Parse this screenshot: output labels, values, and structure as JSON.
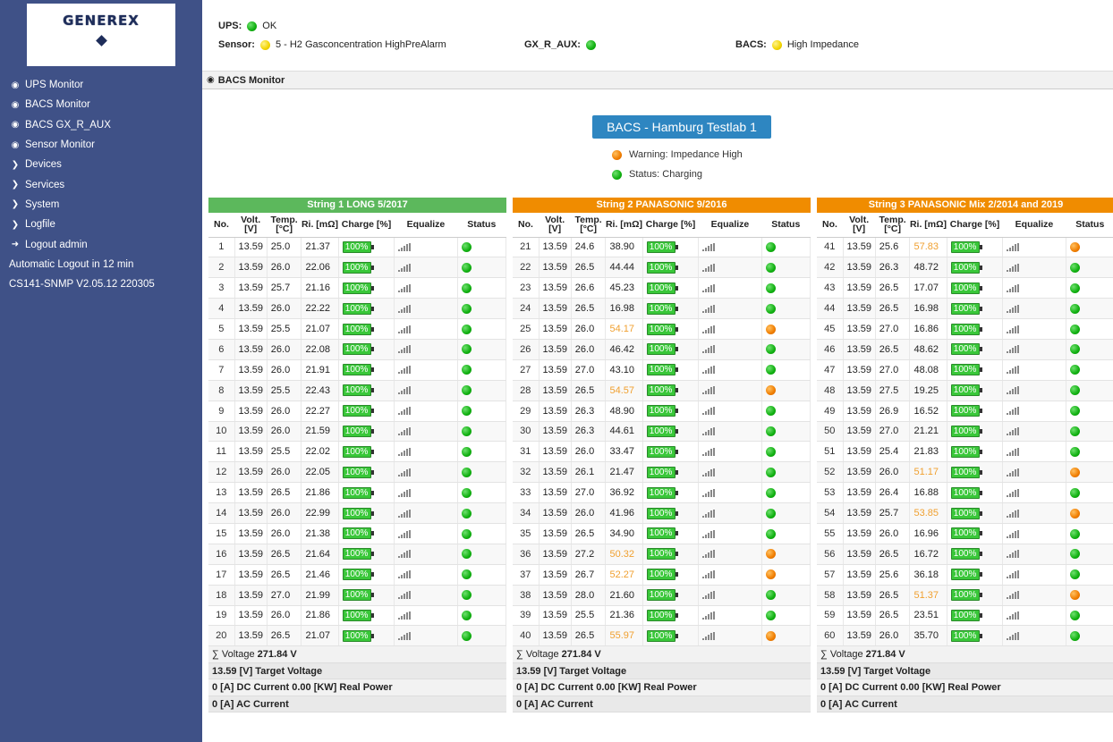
{
  "logo": {
    "text": "GENEREX"
  },
  "sidebar": {
    "items": [
      {
        "label": "UPS Monitor",
        "icon": "dashboard-icon"
      },
      {
        "label": "BACS Monitor",
        "icon": "dashboard-icon"
      },
      {
        "label": "BACS GX_R_AUX",
        "icon": "dashboard-icon"
      },
      {
        "label": "Sensor Monitor",
        "icon": "dashboard-icon"
      },
      {
        "label": "Devices",
        "icon": "chevron-right-icon"
      },
      {
        "label": "Services",
        "icon": "chevron-right-icon"
      },
      {
        "label": "System",
        "icon": "chevron-right-icon"
      },
      {
        "label": "Logfile",
        "icon": "chevron-right-icon"
      },
      {
        "label": "Logout admin",
        "icon": "logout-icon"
      }
    ],
    "auto_logout": "Automatic Logout in 12 min",
    "version": "CS141-SNMP V2.05.12 220305"
  },
  "header": {
    "ups_label": "UPS:",
    "ups_value": "OK",
    "sensor_label": "Sensor:",
    "sensor_value": "5 - H2 Gasconcentration HighPreAlarm",
    "gx_label": "GX_R_AUX:",
    "bacs_label": "BACS:",
    "bacs_value": "High Impedance"
  },
  "breadcrumb": {
    "title": "BACS Monitor"
  },
  "main": {
    "title": "BACS - Hamburg Testlab 1",
    "legend_warning": "Warning: Impedance High",
    "legend_status": "Status: Charging"
  },
  "colors": {
    "ok": "#10b010",
    "warning": "#f07d00",
    "sidebar": "#3f5187",
    "title_blue": "#2e86c1"
  },
  "columns": {
    "no": "No.",
    "volt": "Volt. [V]",
    "temp": "Temp. [°C]",
    "ri": "Ri. [mΩ]",
    "charge": "Charge [%]",
    "equalize": "Equalize",
    "status": "Status"
  },
  "charge_label": "100%",
  "strings": [
    {
      "title": "String 1 LONG 5/2017",
      "color": "green",
      "rows": [
        [
          1,
          "13.59",
          "25.0",
          "21.37",
          "ok"
        ],
        [
          2,
          "13.59",
          "26.0",
          "22.06",
          "ok"
        ],
        [
          3,
          "13.59",
          "25.7",
          "21.16",
          "ok"
        ],
        [
          4,
          "13.59",
          "26.0",
          "22.22",
          "ok"
        ],
        [
          5,
          "13.59",
          "25.5",
          "21.07",
          "ok"
        ],
        [
          6,
          "13.59",
          "26.0",
          "22.08",
          "ok"
        ],
        [
          7,
          "13.59",
          "26.0",
          "21.91",
          "ok"
        ],
        [
          8,
          "13.59",
          "25.5",
          "22.43",
          "ok"
        ],
        [
          9,
          "13.59",
          "26.0",
          "22.27",
          "ok"
        ],
        [
          10,
          "13.59",
          "26.0",
          "21.59",
          "ok"
        ],
        [
          11,
          "13.59",
          "25.5",
          "22.02",
          "ok"
        ],
        [
          12,
          "13.59",
          "26.0",
          "22.05",
          "ok"
        ],
        [
          13,
          "13.59",
          "26.5",
          "21.86",
          "ok"
        ],
        [
          14,
          "13.59",
          "26.0",
          "22.99",
          "ok"
        ],
        [
          15,
          "13.59",
          "26.0",
          "21.38",
          "ok"
        ],
        [
          16,
          "13.59",
          "26.5",
          "21.64",
          "ok"
        ],
        [
          17,
          "13.59",
          "26.5",
          "21.46",
          "ok"
        ],
        [
          18,
          "13.59",
          "27.0",
          "21.99",
          "ok"
        ],
        [
          19,
          "13.59",
          "26.0",
          "21.86",
          "ok"
        ],
        [
          20,
          "13.59",
          "26.5",
          "21.07",
          "ok"
        ]
      ],
      "voltage_label": "∑ Voltage",
      "voltage_value": "271.84 V",
      "target": "13.59 [V] Target Voltage",
      "dc_power": "0 [A] DC Current   0.00 [KW] Real Power",
      "ac": "0 [A] AC Current"
    },
    {
      "title": "String 2 PANASONIC 9/2016",
      "color": "orange",
      "rows": [
        [
          21,
          "13.59",
          "24.6",
          "38.90",
          "ok"
        ],
        [
          22,
          "13.59",
          "26.5",
          "44.44",
          "ok"
        ],
        [
          23,
          "13.59",
          "26.6",
          "45.23",
          "ok"
        ],
        [
          24,
          "13.59",
          "26.5",
          "16.98",
          "ok"
        ],
        [
          25,
          "13.59",
          "26.0",
          "54.17",
          "warn"
        ],
        [
          26,
          "13.59",
          "26.0",
          "46.42",
          "ok"
        ],
        [
          27,
          "13.59",
          "27.0",
          "43.10",
          "ok"
        ],
        [
          28,
          "13.59",
          "26.5",
          "54.57",
          "warn"
        ],
        [
          29,
          "13.59",
          "26.3",
          "48.90",
          "ok"
        ],
        [
          30,
          "13.59",
          "26.3",
          "44.61",
          "ok"
        ],
        [
          31,
          "13.59",
          "26.0",
          "33.47",
          "ok"
        ],
        [
          32,
          "13.59",
          "26.1",
          "21.47",
          "ok"
        ],
        [
          33,
          "13.59",
          "27.0",
          "36.92",
          "ok"
        ],
        [
          34,
          "13.59",
          "26.0",
          "41.96",
          "ok"
        ],
        [
          35,
          "13.59",
          "26.5",
          "34.90",
          "ok"
        ],
        [
          36,
          "13.59",
          "27.2",
          "50.32",
          "warn"
        ],
        [
          37,
          "13.59",
          "26.7",
          "52.27",
          "warn"
        ],
        [
          38,
          "13.59",
          "28.0",
          "21.60",
          "ok"
        ],
        [
          39,
          "13.59",
          "25.5",
          "21.36",
          "ok"
        ],
        [
          40,
          "13.59",
          "26.5",
          "55.97",
          "warn"
        ]
      ],
      "voltage_label": "∑ Voltage",
      "voltage_value": "271.84 V",
      "target": "13.59 [V] Target Voltage",
      "dc_power": "0 [A] DC Current   0.00 [KW] Real Power",
      "ac": "0 [A] AC Current"
    },
    {
      "title": "String 3 PANASONIC Mix 2/2014 and 2019",
      "color": "orange",
      "rows": [
        [
          41,
          "13.59",
          "25.6",
          "57.83",
          "warn"
        ],
        [
          42,
          "13.59",
          "26.3",
          "48.72",
          "ok"
        ],
        [
          43,
          "13.59",
          "26.5",
          "17.07",
          "ok"
        ],
        [
          44,
          "13.59",
          "26.5",
          "16.98",
          "ok"
        ],
        [
          45,
          "13.59",
          "27.0",
          "16.86",
          "ok"
        ],
        [
          46,
          "13.59",
          "26.5",
          "48.62",
          "ok"
        ],
        [
          47,
          "13.59",
          "27.0",
          "48.08",
          "ok"
        ],
        [
          48,
          "13.59",
          "27.5",
          "19.25",
          "ok"
        ],
        [
          49,
          "13.59",
          "26.9",
          "16.52",
          "ok"
        ],
        [
          50,
          "13.59",
          "27.0",
          "21.21",
          "ok"
        ],
        [
          51,
          "13.59",
          "25.4",
          "21.83",
          "ok"
        ],
        [
          52,
          "13.59",
          "26.0",
          "51.17",
          "warn"
        ],
        [
          53,
          "13.59",
          "26.4",
          "16.88",
          "ok"
        ],
        [
          54,
          "13.59",
          "25.7",
          "53.85",
          "warn"
        ],
        [
          55,
          "13.59",
          "26.0",
          "16.96",
          "ok"
        ],
        [
          56,
          "13.59",
          "26.5",
          "16.72",
          "ok"
        ],
        [
          57,
          "13.59",
          "25.6",
          "36.18",
          "ok"
        ],
        [
          58,
          "13.59",
          "26.5",
          "51.37",
          "warn"
        ],
        [
          59,
          "13.59",
          "26.5",
          "23.51",
          "ok"
        ],
        [
          60,
          "13.59",
          "26.0",
          "35.70",
          "ok"
        ]
      ],
      "voltage_label": "∑ Voltage",
      "voltage_value": "271.84 V",
      "target": "13.59 [V] Target Voltage",
      "dc_power": "0 [A] DC Current   0.00 [KW] Real Power",
      "ac": "0 [A] AC Current"
    }
  ]
}
